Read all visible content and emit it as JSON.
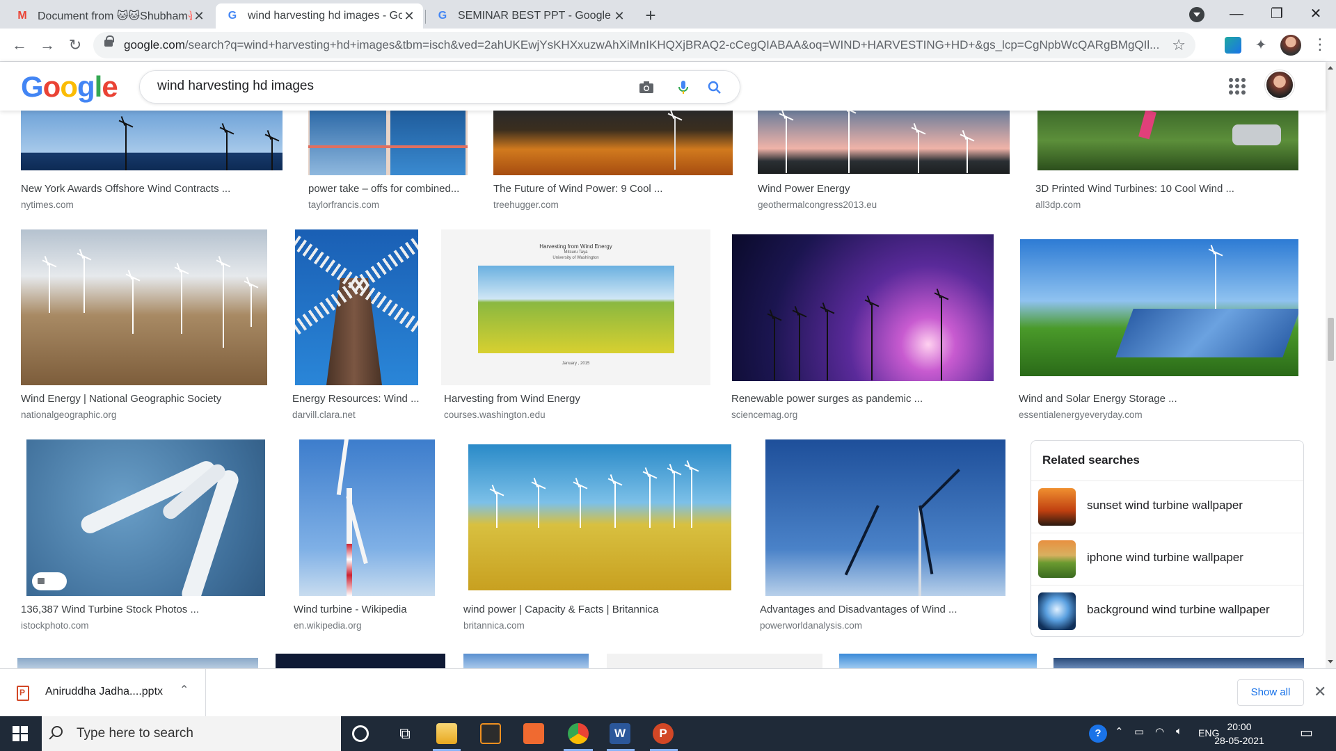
{
  "tabs": [
    {
      "title": "Document from 🐱🐱Shubham🐙",
      "favicon": "gmail-icon",
      "active": false
    },
    {
      "title": "wind harvesting hd images - Goo",
      "favicon": "google-icon",
      "active": true
    },
    {
      "title": "SEMINAR BEST PPT - Google Sea",
      "favicon": "google-icon",
      "active": false
    }
  ],
  "omnibox": {
    "host": "google.com",
    "path": "/search?q=wind+harvesting+hd+images&tbm=isch&ved=2ahUKEwjYsKHXxuzwAhXiMnIKHQXjBRAQ2-cCegQIABAA&oq=WIND+HARVESTING+HD+&gs_lcp=CgNpbWcQARgBMgQIl..."
  },
  "google": {
    "logo_letters": [
      "G",
      "o",
      "o",
      "g",
      "l",
      "e"
    ],
    "logo_colors": [
      "#4285f4",
      "#ea4335",
      "#fbbc05",
      "#4285f4",
      "#34a853",
      "#ea4335"
    ],
    "query": "wind harvesting hd images"
  },
  "results": [
    {
      "title": "New York Awards Offshore Wind Contracts ...",
      "source": "nytimes.com"
    },
    {
      "title": "power take – offs for combined...",
      "source": "taylorfrancis.com"
    },
    {
      "title": "The Future of Wind Power: 9 Cool ...",
      "source": "treehugger.com"
    },
    {
      "title": "Wind Power Energy",
      "source": "geothermalcongress2013.eu"
    },
    {
      "title": "3D Printed Wind Turbines: 10 Cool Wind ...",
      "source": "all3dp.com"
    },
    {
      "title": "Wind Energy | National Geographic Society",
      "source": "nationalgeographic.org"
    },
    {
      "title": "Energy Resources: Wind ...",
      "source": "darvill.clara.net"
    },
    {
      "title": "Harvesting from Wind Energy",
      "source": "courses.washington.edu"
    },
    {
      "title": "Renewable power surges as pandemic ...",
      "source": "sciencemag.org"
    },
    {
      "title": "Wind and Solar Energy Storage ...",
      "source": "essentialenergyeveryday.com"
    },
    {
      "title": "136,387 Wind Turbine Stock Photos ...",
      "source": "istockphoto.com"
    },
    {
      "title": "Wind turbine - Wikipedia",
      "source": "en.wikipedia.org"
    },
    {
      "title": "wind power | Capacity & Facts | Britannica",
      "source": "britannica.com"
    },
    {
      "title": "Advantages and Disadvantages of Wind ...",
      "source": "powerworldanalysis.com"
    }
  ],
  "slide_text": {
    "heading": "Harvesting from Wind Energy",
    "sub1": "Mitsuru Taya",
    "sub2": "University of Washington",
    "date": "January , 2015"
  },
  "related": {
    "heading": "Related searches",
    "items": [
      "sunset wind turbine wallpaper",
      "iphone wind turbine wallpaper",
      "background wind turbine wallpaper"
    ]
  },
  "download": {
    "filename": "Aniruddha Jadha....pptx",
    "show_all": "Show all"
  },
  "taskbar": {
    "search_placeholder": "Type here to search",
    "lang": "ENG",
    "time": "20:00",
    "date": "28-05-2021"
  }
}
